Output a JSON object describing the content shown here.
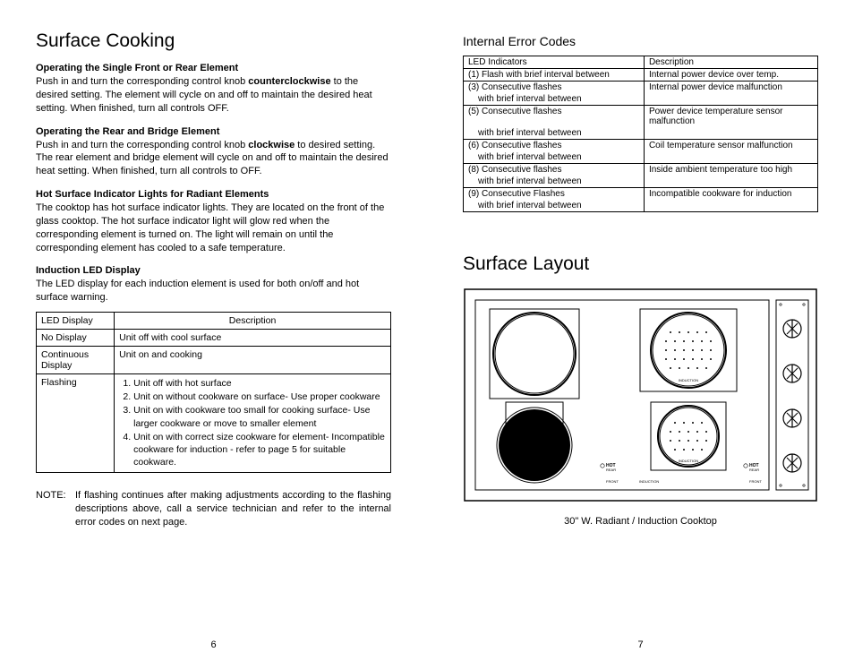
{
  "left": {
    "title": "Surface Cooking",
    "section1": {
      "heading": "Operating the Single Front or Rear Element",
      "text_a": "Push in and turn the corresponding control knob ",
      "bold": "counterclockwise",
      "text_b": " to the desired setting. The element will cycle on and off to maintain the desired heat setting. When finished, turn all controls OFF."
    },
    "section2": {
      "heading": "Operating the Rear and Bridge Element",
      "text_a": "Push in and turn the corresponding control knob ",
      "bold": "clockwise",
      "text_b": " to desired setting. The rear element and bridge element will cycle on and off to maintain the desired heat setting. When finished, turn all controls to OFF."
    },
    "section3": {
      "heading": "Hot Surface Indicator Lights for Radiant Elements",
      "text": "The cooktop has hot surface indicator lights. They are located on the front of the glass cooktop. The hot surface indicator light will glow red when the corresponding element is turned on. The light will remain on until the corresponding element has cooled to a safe temperature."
    },
    "section4": {
      "heading": "Induction LED Display",
      "text": "The LED display for each induction element is used for both on/off and hot surface warning."
    },
    "ledTable": {
      "h1": "LED Display",
      "h2": "Description",
      "rows": [
        {
          "c1": "No Display",
          "c2": "Unit off with cool surface"
        },
        {
          "c1": "Continuous Display",
          "c2": "Unit on and cooking"
        }
      ],
      "flashLabel": "Flashing",
      "flashItems": [
        "Unit off with hot surface",
        "Unit on without cookware on surface- Use proper cookware",
        "Unit on with cookware too small for cooking surface- Use larger cookware or move to smaller element",
        "Unit on with correct size cookware for element- Incompatible cookware for induction - refer to page 5 for suitable cookware."
      ]
    },
    "noteLabel": "NOTE:",
    "noteText": "If flashing continues after making adjustments according to the flashing descriptions above, call a service technician and refer to the internal error codes on next page.",
    "pageNum": "6"
  },
  "right": {
    "errTitle": "Internal Error Codes",
    "errHeaders": {
      "c1": "LED Indicators",
      "c2": "Description"
    },
    "errRows": [
      {
        "c1a": "(1) Flash with brief interval between",
        "c1b": "",
        "c2": "Internal power device over temp."
      },
      {
        "c1a": "(3) Consecutive flashes",
        "c1b": "with brief interval between",
        "c2": "Internal power device malfunction"
      },
      {
        "c1a": "(5) Consecutive flashes",
        "c1b": "with brief interval between",
        "c2": "Power device temperature sensor malfunction"
      },
      {
        "c1a": "(6) Consecutive flashes",
        "c1b": "with brief interval between",
        "c2": "Coil temperature sensor malfunction"
      },
      {
        "c1a": "(8) Consecutive flashes",
        "c1b": "with brief interval between",
        "c2": "Inside ambient temperature too high"
      },
      {
        "c1a": "(9) Consecutive Flashes",
        "c1b": "with brief interval between",
        "c2": "Incompatible cookware for induction"
      }
    ],
    "layoutTitle": "Surface Layout",
    "caption": "30\" W. Radiant / Induction Cooktop",
    "labels": {
      "hot": "HOT",
      "rear": "REAR",
      "front": "FRONT",
      "induction": "INDUCTION"
    },
    "pageNum": "7"
  }
}
